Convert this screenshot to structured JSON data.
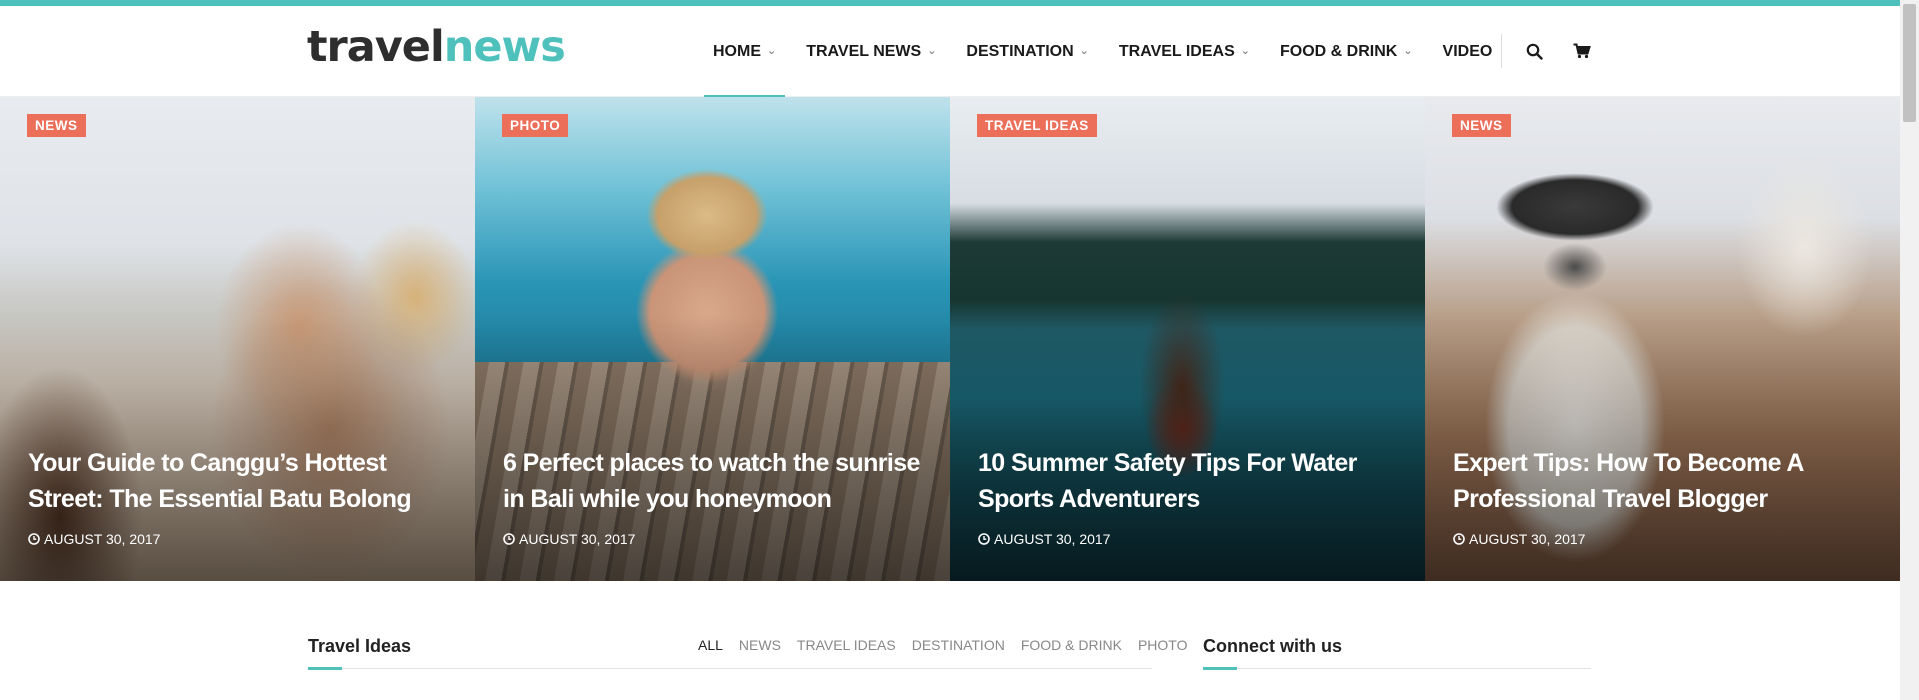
{
  "logo": {
    "part1": "travel",
    "part2": "news"
  },
  "nav": {
    "items": [
      {
        "label": "HOME",
        "dropdown": true,
        "active": true
      },
      {
        "label": "TRAVEL NEWS",
        "dropdown": true
      },
      {
        "label": "DESTINATION",
        "dropdown": true
      },
      {
        "label": "TRAVEL IDEAS",
        "dropdown": true
      },
      {
        "label": "FOOD & DRINK",
        "dropdown": true
      },
      {
        "label": "VIDEO",
        "dropdown": false
      }
    ],
    "search_icon": "search-icon",
    "cart_icon": "cart-icon"
  },
  "hero": {
    "slides": [
      {
        "category": "NEWS",
        "title": "Your Guide to Canggu’s Hottest Street: The Essential Batu Bolong",
        "date": "AUGUST 30, 2017"
      },
      {
        "category": "PHOTO",
        "title": "6 Perfect places to watch the sunrise in Bali while you honeymoon",
        "date": "AUGUST 30, 2017"
      },
      {
        "category": "TRAVEL IDEAS",
        "title": "10 Summer Safety Tips For Water Sports Adventurers",
        "date": "AUGUST 30, 2017"
      },
      {
        "category": "NEWS",
        "title": "Expert Tips: How To Become A Professional Travel Blogger",
        "date": "AUGUST 30, 2017"
      }
    ]
  },
  "travel_ideas": {
    "heading": "Travel Ideas",
    "filters": [
      "ALL",
      "NEWS",
      "TRAVEL IDEAS",
      "DESTINATION",
      "FOOD & DRINK",
      "PHOTO"
    ]
  },
  "connect": {
    "heading": "Connect with us"
  },
  "colors": {
    "accent": "#4fc1bd",
    "badge": "#ec6f5a",
    "text": "#1a1a1a"
  }
}
